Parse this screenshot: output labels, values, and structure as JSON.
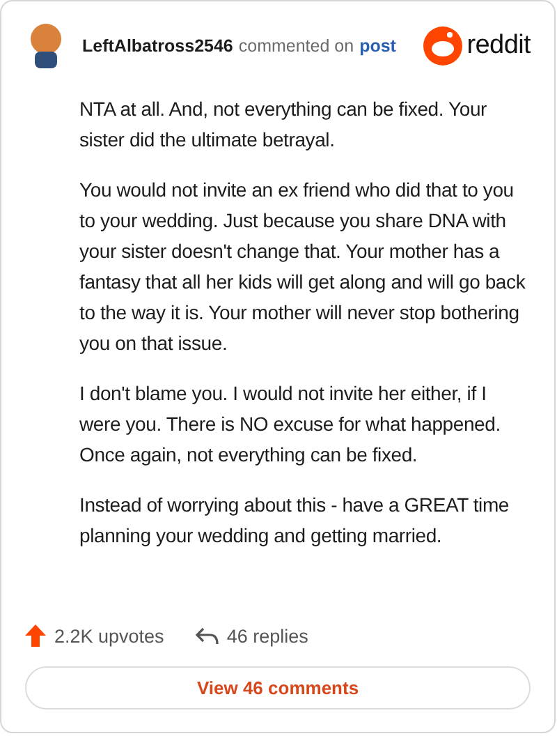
{
  "comment": {
    "author": "LeftAlbatross2546",
    "action": "commented on",
    "link": "post",
    "brand": "reddit",
    "paragraphs": [
      "NTA at all. And, not everything can be fixed. Your sister did the ultimate betrayal.",
      "You would not invite an ex friend who did that to you to your wedding. Just because you share DNA with your sister doesn't change that. Your mother has a fantasy that all her kids will get along and will go back to the way it is. Your mother will never stop bothering you on that issue.",
      "I don't blame you. I would not invite her either, if I were you. There is NO excuse for what happened. Once again, not everything can be fixed.",
      "Instead of worrying about this - have a GREAT time planning your wedding and getting married."
    ],
    "upvotes": "2.2K upvotes",
    "replies": "46 replies",
    "view_button": "View 46 comments"
  }
}
